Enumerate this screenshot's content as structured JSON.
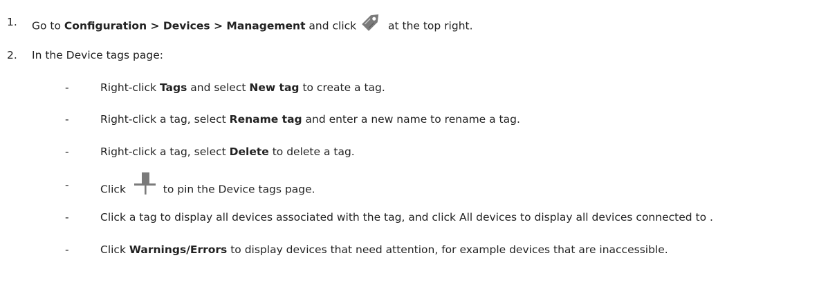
{
  "steps": [
    {
      "number": "1.",
      "parts": {
        "t1": "Go to ",
        "b1": "Configuration > Devices > Management",
        "t2": " and click ",
        "t3": " at the top right."
      },
      "icon": "tag-icon"
    },
    {
      "number": "2.",
      "text": "In the Device tags page:"
    }
  ],
  "bullets": [
    {
      "marker": "-",
      "t1": "Right-click ",
      "b1": "Tags",
      "t2": " and select ",
      "b2": "New tag",
      "t3": " to create a tag."
    },
    {
      "marker": "-",
      "t1": "Right-click a tag, select ",
      "b1": "Rename tag",
      "t2": " and enter a new name to rename a tag."
    },
    {
      "marker": "-",
      "t1": "Right-click a tag, select ",
      "b1": "Delete",
      "t2": " to delete a tag."
    },
    {
      "marker": "-",
      "t1": "Click ",
      "t2": " to pin the Device tags page.",
      "icon": "pin-icon"
    },
    {
      "marker": "-",
      "t1": "Click a tag to display all devices associated with the tag, and click All devices to display all devices connected to ."
    },
    {
      "marker": "-",
      "t1": "Click ",
      "b1": "Warnings/Errors",
      "t2": " to display devices that need attention, for example devices that are inaccessible."
    }
  ],
  "colors": {
    "text": "#222222",
    "icon": "#7a7a7a"
  }
}
